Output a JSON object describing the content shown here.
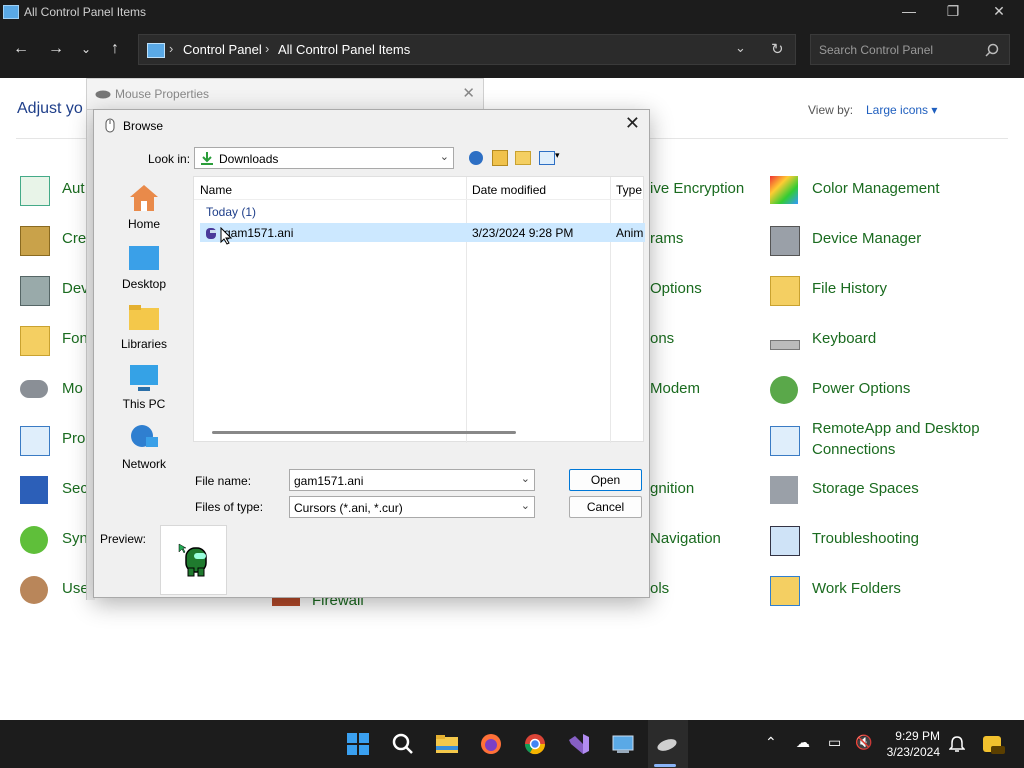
{
  "window": {
    "title": "All Control Panel Items"
  },
  "address_bar": {
    "crumbs": [
      "Control Panel",
      "All Control Panel Items"
    ]
  },
  "search": {
    "placeholder": "Search Control Panel"
  },
  "control_panel": {
    "heading": "Adjust yo",
    "view_by_label": "View by:",
    "view_by_value": "Large icons ▾",
    "left_items": [
      "Aut",
      "Cre",
      "Dev",
      "Fon",
      "Mo",
      "Pro",
      "Sec",
      "Sync",
      "User"
    ],
    "mid_items": [
      "ive Encryption",
      "rams",
      "Options",
      "ons",
      "Modem",
      "gnition",
      "Navigation",
      "ols"
    ],
    "firewall": "Firewall",
    "right_items": [
      "Color Management",
      "Device Manager",
      "File History",
      "Keyboard",
      "Power Options",
      "RemoteApp and Desktop",
      "Connections",
      "Storage Spaces",
      "Troubleshooting",
      "Work Folders"
    ]
  },
  "mouse_dialog": {
    "title": "Mouse Properties"
  },
  "browse": {
    "title": "Browse",
    "look_in_label": "Look in:",
    "look_in_value": "Downloads",
    "places": [
      "Home",
      "Desktop",
      "Libraries",
      "This PC",
      "Network"
    ],
    "columns": [
      "Name",
      "Date modified",
      "Type"
    ],
    "group": "Today (1)",
    "file": {
      "name": "gam1571.ani",
      "date": "3/23/2024 9:28 PM",
      "type": "Anim"
    },
    "file_name_label": "File name:",
    "file_name_value": "gam1571.ani",
    "files_of_type_label": "Files of type:",
    "files_of_type_value": "Cursors (*.ani, *.cur)",
    "open_label": "Open",
    "cancel_label": "Cancel",
    "preview_label": "Preview:"
  },
  "taskbar": {
    "time": "9:29 PM",
    "date": "3/23/2024"
  },
  "colors": {
    "accent": "#0078d7",
    "link": "#1a6b1f",
    "selection": "#cce8ff"
  }
}
